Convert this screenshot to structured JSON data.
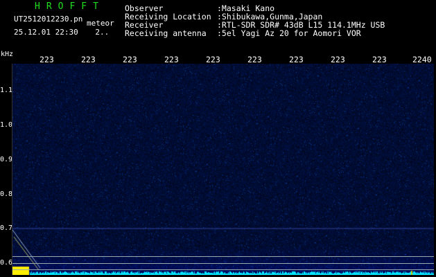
{
  "brand": "HROFFT",
  "file_name": "UT2512012230.pn",
  "meteor_label": "meteor",
  "date_time": "25.12.01 22:30",
  "count_text": "2..",
  "info": [
    {
      "label": "Observer",
      "value": ":Masaki Kano"
    },
    {
      "label": "Receiving Location",
      "value": ":Shibukawa,Gunma,Japan"
    },
    {
      "label": "Receiver",
      "value": ":RTL-SDR SDR# 43dB L15 114.1MHz USB"
    },
    {
      "label": "Receiving antenna",
      "value": ":5el Yagi Az 20 for Aomori VOR"
    }
  ],
  "y_unit": "kHz",
  "y_ticks": [
    "1.1",
    "1.0",
    "0.9",
    "0.8",
    "0.7",
    "0.6"
  ],
  "x_ticks": [
    "223",
    "223",
    "223",
    "223",
    "223",
    "223",
    "223",
    "223",
    "223",
    "2240"
  ],
  "colors": {
    "background": "#000000",
    "spectrum": "#000a3a",
    "brand": "#1fe01f",
    "cyan_trace": "#00e5ff",
    "yellow": "#ffee00"
  }
}
